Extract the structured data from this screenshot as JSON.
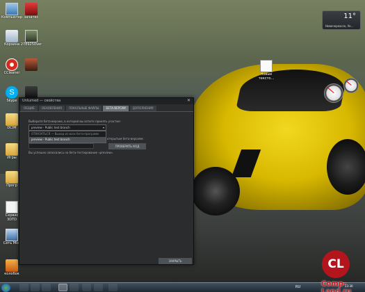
{
  "desktop": {
    "icons": [
      {
        "label": "Компьютер"
      },
      {
        "label": "Корзина"
      },
      {
        "label": "CCleaner"
      },
      {
        "label": "Skype"
      },
      {
        "label": "DCIM"
      },
      {
        "label": "Игры"
      },
      {
        "label": "Прогр"
      },
      {
        "label": "Сервис 3DTD"
      },
      {
        "label": "Сеть Micr"
      },
      {
        "label": "колобок"
      },
      {
        "label": "зачатес"
      },
      {
        "label": "2789250ver"
      },
      {
        "label": "Новые тексто..."
      }
    ]
  },
  "weather": {
    "temp": "11°",
    "city": "Новочеркасск, Ук..."
  },
  "steam_window": {
    "title": "Unturned — свойства",
    "close": "✕",
    "tabs": [
      "ОБЩИЕ",
      "ОБНОВЛЕНИЯ",
      "ЛОКАЛЬНЫЕ ФАЙЛЫ",
      "БЕТА-ВЕРСИИ",
      "ДОПОЛНЕНИЯ"
    ],
    "active_tab_index": 3,
    "choose_label": "Выберите бета-версию, в которой вы хотите принять участие:",
    "selected_value": "preview - Public test branch",
    "dropdown_options": [
      "ОТКАЗАТЬСЯ — Выход из всех бета-программ",
      "preview - Public test branch"
    ],
    "highlighted_option_index": 1,
    "code_label": "открытым бета-версиям:",
    "check_code_button": "ПРОВЕРИТЬ КОД",
    "success_text": "Вы успешно записались на бета-тестирование «preview».",
    "close_button": "ЗАКРЫТЬ"
  },
  "taskbar": {
    "language": "RU",
    "time": "23:30"
  },
  "watermark": "Comp-Land.ru",
  "logo_text": "CL"
}
